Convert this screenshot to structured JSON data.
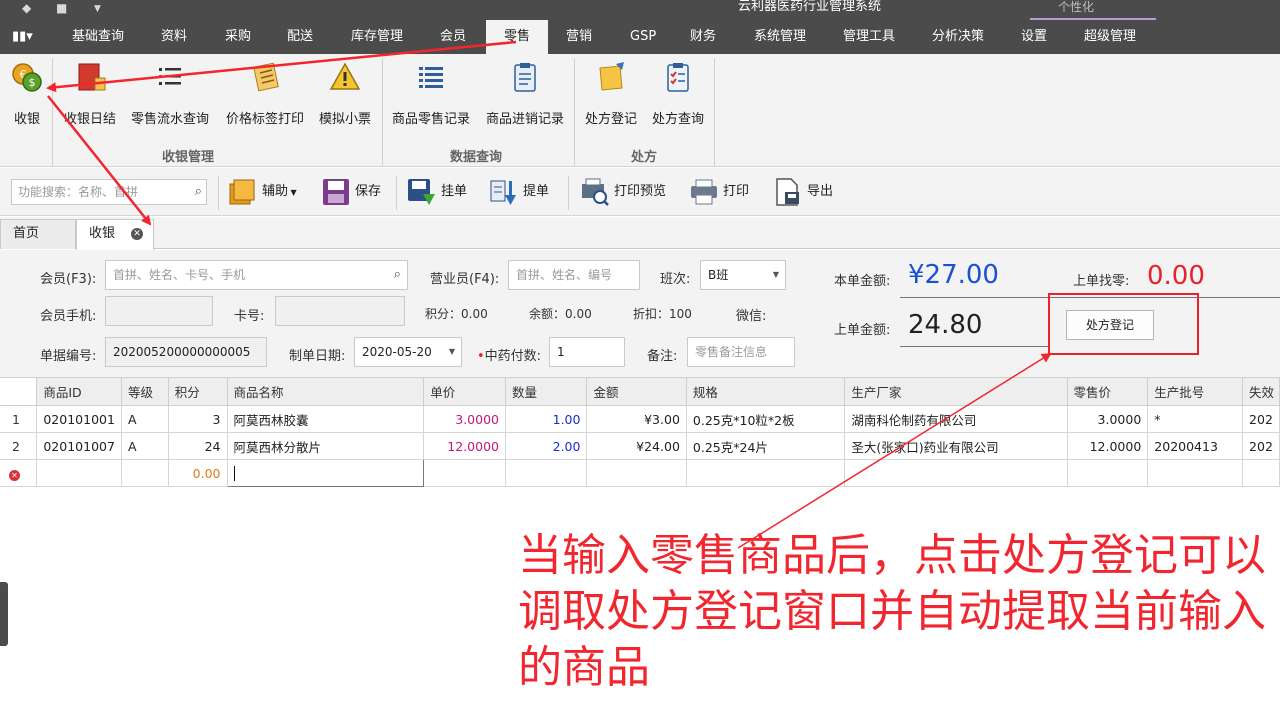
{
  "titlebar": {
    "app_title": "云利器医药行业管理系统",
    "personalize": "个性化"
  },
  "menu": {
    "items": [
      {
        "label": "基础查询"
      },
      {
        "label": "资料"
      },
      {
        "label": "采购"
      },
      {
        "label": "配送"
      },
      {
        "label": "库存管理"
      },
      {
        "label": "会员"
      },
      {
        "label": "零售",
        "active": true
      },
      {
        "label": "营销"
      },
      {
        "label": "GSP"
      },
      {
        "label": "财务"
      },
      {
        "label": "系统管理"
      },
      {
        "label": "管理工具"
      },
      {
        "label": "分析决策"
      },
      {
        "label": "设置"
      },
      {
        "label": "超级管理"
      }
    ]
  },
  "ribbon": {
    "buttons": [
      {
        "label": "收银",
        "icon": "coins-icon"
      },
      {
        "label": "收银日结",
        "icon": "ledger-book-icon"
      },
      {
        "label": "零售流水查询",
        "icon": "list-icon"
      },
      {
        "label": "价格标签打印",
        "icon": "price-tag-icon"
      },
      {
        "label": "模拟小票",
        "icon": "warning-icon"
      },
      {
        "label": "商品零售记录",
        "icon": "grid-list-icon"
      },
      {
        "label": "商品进销记录",
        "icon": "clipboard-icon"
      },
      {
        "label": "处方登记",
        "icon": "sticky-note-icon"
      },
      {
        "label": "处方查询",
        "icon": "checklist-icon"
      }
    ],
    "groups": [
      {
        "label": "收银管理"
      },
      {
        "label": "数据查询"
      },
      {
        "label": "处方"
      }
    ]
  },
  "toolbar": {
    "search_placeholder": "功能搜索：名称、首拼",
    "buttons": [
      {
        "label": "辅助",
        "icon": "books-icon",
        "dropdown": true
      },
      {
        "label": "保存",
        "icon": "save-icon"
      },
      {
        "label": "挂单",
        "icon": "hold-order-icon"
      },
      {
        "label": "提单",
        "icon": "retrieve-order-icon"
      },
      {
        "label": "打印预览",
        "icon": "print-preview-icon"
      },
      {
        "label": "打印",
        "icon": "printer-icon"
      },
      {
        "label": "导出",
        "icon": "export-icon"
      }
    ]
  },
  "tabs": [
    {
      "label": "首页"
    },
    {
      "label": "收银",
      "active": true
    }
  ],
  "form": {
    "member_label": "会员(F3):",
    "member_placeholder": "首拼、姓名、卡号、手机",
    "clerk_label": "营业员(F4):",
    "clerk_placeholder": "首拼、姓名、编号",
    "shift_label": "班次:",
    "shift_value": "B班",
    "phone_label": "会员手机:",
    "card_label": "卡号:",
    "points_text": "积分：0.00",
    "balance_text": "余额：0.00",
    "discount_text": "折扣：100",
    "wechat_label": "微信:",
    "doc_no_label": "单据编号:",
    "doc_no_value": "202005200000000005",
    "date_label": "制单日期:",
    "date_value": "2020-05-20",
    "tcm_label": "中药付数:",
    "tcm_value": "1",
    "remark_label": "备注:",
    "remark_placeholder": "零售备注信息",
    "current_amount_label": "本单金额:",
    "current_amount_value": "¥27.00",
    "last_change_label": "上单找零:",
    "last_change_value": "0.00",
    "last_amount_label": "上单金额:",
    "last_amount_value": "24.80",
    "prescription_button": "处方登记"
  },
  "grid": {
    "columns": [
      "商品ID",
      "等级",
      "积分",
      "商品名称",
      "单价",
      "数量",
      "金额",
      "规格",
      "生产厂家",
      "零售价",
      "生产批号",
      "失效"
    ],
    "rows": [
      {
        "no": "1",
        "id": "020101001",
        "grade": "A",
        "points": "3",
        "name": "阿莫西林胶囊",
        "unit_price": "3.0000",
        "qty": "1.00",
        "amount": "¥3.00",
        "spec": "0.25克*10粒*2板",
        "maker": "湖南科伦制药有限公司",
        "retail": "3.0000",
        "batch": "*",
        "expiry": "202"
      },
      {
        "no": "2",
        "id": "020101007",
        "grade": "A",
        "points": "24",
        "name": "阿莫西林分散片",
        "unit_price": "12.0000",
        "qty": "2.00",
        "amount": "¥24.00",
        "spec": "0.25克*24片",
        "maker": "圣大(张家口)药业有限公司",
        "retail": "12.0000",
        "batch": "20200413",
        "expiry": "202"
      }
    ],
    "new_row": {
      "points": "0.00",
      "name": ""
    }
  },
  "annotation": {
    "text": "当输入零售商品后，点击处方登记可以调取处方登记窗口并自动提取当前输入的商品",
    "color": "#f2262e"
  },
  "colors": {
    "menubar": "#4b4b4b",
    "ribbon": "#f3f3f3",
    "amount_blue": "#1a4fd6",
    "change_red": "#e8212b",
    "price_pink": "#c2187a",
    "qty_blue": "#1a2bd0"
  }
}
